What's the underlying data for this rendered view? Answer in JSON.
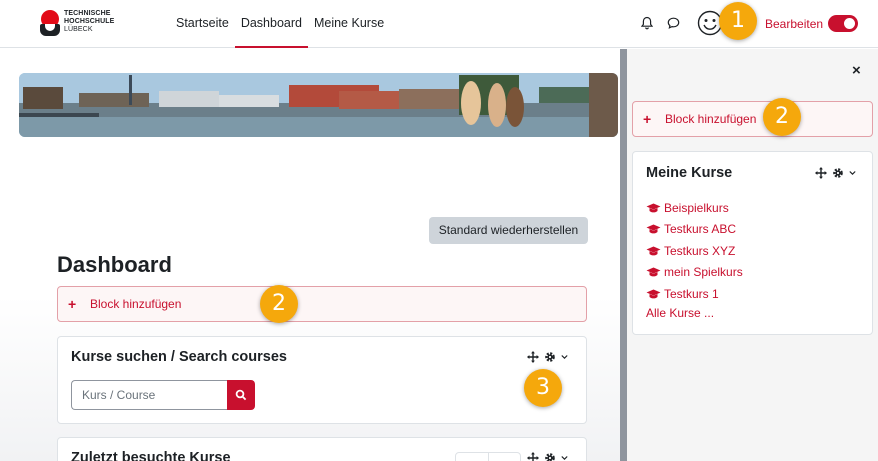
{
  "logo": {
    "line1": "TECHNISCHE",
    "line2": "HOCHSCHULE",
    "line3": "LÜBECK"
  },
  "nav": {
    "links": [
      {
        "label": "Startseite",
        "active": false
      },
      {
        "label": "Dashboard",
        "active": true
      },
      {
        "label": "Meine Kurse",
        "active": false
      }
    ],
    "edit_label": "Bearbeiten",
    "edit_mode": true,
    "icons": [
      "bell-icon",
      "chat-icon",
      "smiley-avatar-icon"
    ]
  },
  "callouts": {
    "badge1": "1",
    "badge2a": "2",
    "badge2b": "2",
    "badge3": "3"
  },
  "main": {
    "restore_button": "Standard wiederherstellen",
    "title": "Dashboard",
    "add_block": {
      "plus": "+",
      "label": "Block hinzufügen"
    },
    "blocks": [
      {
        "title": "Kurse suchen / Search courses",
        "search_placeholder": "Kurs / Course"
      },
      {
        "title": "Zuletzt besuchte Kurse"
      }
    ]
  },
  "drawer": {
    "close": "×",
    "add_block": {
      "plus": "+",
      "label": "Block hinzufügen"
    },
    "my_courses": {
      "title": "Meine Kurse",
      "items": [
        "Beispielkurs",
        "Testkurs ABC",
        "Testkurs XYZ",
        "mein Spielkurs",
        "Testkurs 1"
      ],
      "all_link": "Alle Kurse ..."
    }
  },
  "colors": {
    "brand": "#c8102e",
    "badge": "#f5a80c",
    "drawer_bg": "#f5f5f5",
    "separator": "#8f959e"
  }
}
